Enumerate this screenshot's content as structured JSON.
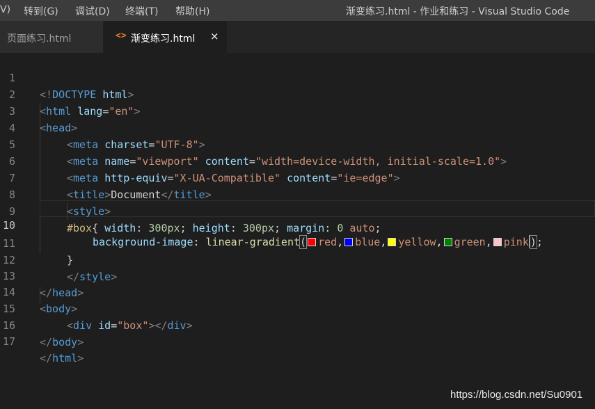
{
  "menubar": {
    "items": [
      "V)",
      "转到(G)",
      "调试(D)",
      "终端(T)",
      "帮助(H)"
    ],
    "title": "渐变练习.html - 作业和练习 - Visual Studio Code"
  },
  "tabs": [
    {
      "label": "页面练习.html",
      "active": false
    },
    {
      "label": "渐变练习.html",
      "active": true,
      "close_glyph": "×"
    }
  ],
  "editor": {
    "line_numbers": [
      "1",
      "2",
      "3",
      "4",
      "5",
      "6",
      "7",
      "8",
      "9",
      "10",
      "11",
      "12",
      "13",
      "14",
      "15",
      "16",
      "17"
    ],
    "active_line": "10",
    "lines": [
      [
        "<!",
        "DOCTYPE",
        " ",
        "html",
        ">"
      ],
      [
        "<",
        "html",
        " ",
        "lang",
        "=",
        "\"en\"",
        ">"
      ],
      [
        "<",
        "head",
        ">"
      ],
      [
        "<",
        "meta",
        " ",
        "charset",
        "=",
        "\"UTF-8\"",
        ">"
      ],
      [
        "<",
        "meta",
        " ",
        "name",
        "=",
        "\"viewport\"",
        " ",
        "content",
        "=",
        "\"width=device-width, initial-scale=1.0\"",
        ">"
      ],
      [
        "<",
        "meta",
        " ",
        "http-equiv",
        "=",
        "\"X-UA-Compatible\"",
        " ",
        "content",
        "=",
        "\"ie=edge\"",
        ">"
      ],
      [
        "<",
        "title",
        ">",
        "Document",
        "</",
        "title",
        ">"
      ],
      [
        "<",
        "style",
        ">"
      ],
      [
        "#box",
        "{ ",
        "width",
        ": ",
        "300px",
        "; ",
        "height",
        ": ",
        "300px",
        "; ",
        "margin",
        ": ",
        "0",
        " ",
        "auto",
        ";"
      ],
      [
        "background-image",
        ": ",
        "linear-gradient",
        "(",
        "red",
        ",",
        "blue",
        ",",
        "yellow",
        ",",
        "green",
        ",",
        "pink",
        ")",
        ";"
      ],
      [
        "}"
      ],
      [
        "</",
        "style",
        ">"
      ],
      [
        "</",
        "head",
        ">"
      ],
      [
        "<",
        "body",
        ">"
      ],
      [
        "<",
        "div",
        " ",
        "id",
        "=",
        "\"box\"",
        ">",
        "</",
        "div",
        ">"
      ],
      [
        "</",
        "body",
        ">"
      ],
      [
        "</",
        "html",
        ">"
      ]
    ],
    "swatch_colors": [
      "#ff0000",
      "#0000ff",
      "#ffff00",
      "#008000",
      "#ffc0cb"
    ]
  },
  "watermark": "https://blog.csdn.net/Su0901",
  "colors": {
    "background": "#1e1e1e",
    "menubar": "#3c3c3c",
    "tag": "#569cd6",
    "attribute": "#9cdcfe",
    "string": "#ce9178",
    "selector": "#d7ba7d",
    "number": "#b5cea8",
    "function": "#dcdcaa"
  }
}
